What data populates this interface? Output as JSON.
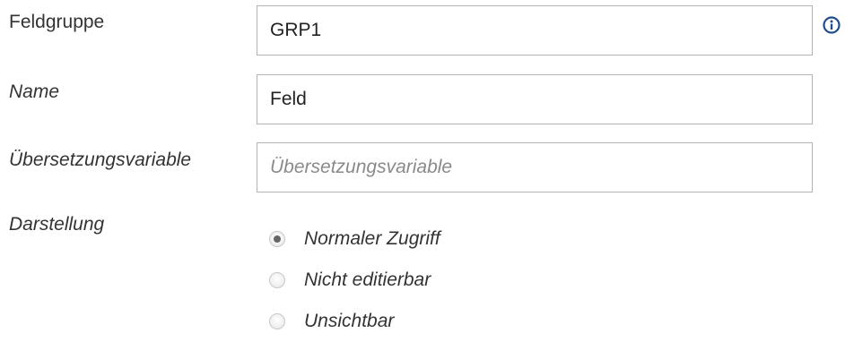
{
  "form": {
    "feldgruppe": {
      "label": "Feldgruppe",
      "value": "GRP1",
      "info_icon": "info-icon"
    },
    "name": {
      "label": "Name",
      "value": "Feld"
    },
    "uebersetzungsvariable": {
      "label": "Übersetzungsvariable",
      "value": "",
      "placeholder": "Übersetzungsvariable"
    },
    "darstellung": {
      "label": "Darstellung",
      "selected": "Normaler Zugriff",
      "options": [
        {
          "label": "Normaler Zugriff",
          "checked": true
        },
        {
          "label": "Nicht editierbar",
          "checked": false
        },
        {
          "label": "Unsichtbar",
          "checked": false
        }
      ]
    }
  },
  "colors": {
    "info_icon": "#1f4e8c",
    "border": "#b3b3b3",
    "text": "#333333",
    "placeholder": "#8a8a8a"
  }
}
